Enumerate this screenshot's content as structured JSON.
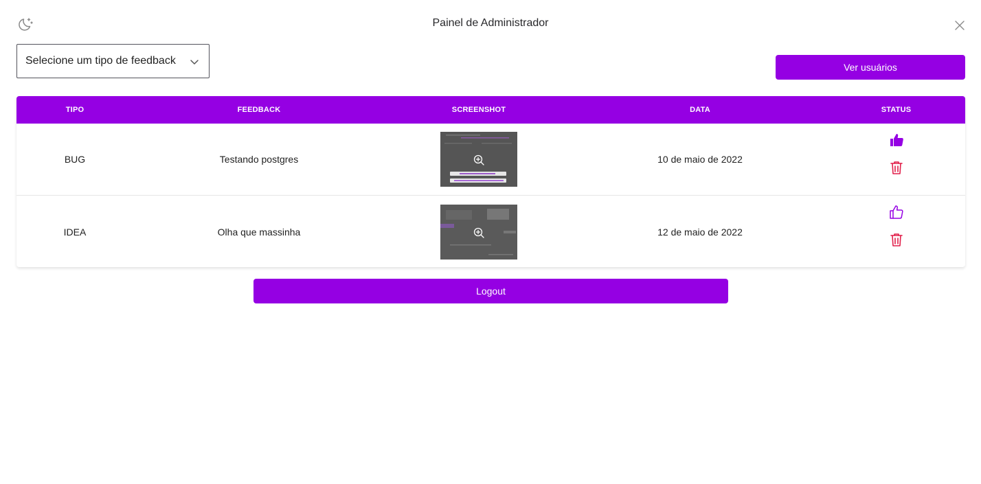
{
  "header": {
    "title": "Painel de Administrador"
  },
  "filter": {
    "selected": "Selecione um tipo de feedback"
  },
  "actions": {
    "users_label": "Ver usuários",
    "logout_label": "Logout"
  },
  "colors": {
    "accent": "#9500e3",
    "danger": "#e11d48"
  },
  "table": {
    "columns": [
      "TIPO",
      "FEEDBACK",
      "SCREENSHOT",
      "DATA",
      "STATUS"
    ],
    "rows": [
      {
        "tipo": "BUG",
        "feedback": "Testando postgres",
        "data": "10 de maio de 2022",
        "status_icon": "thumbs-up-filled-icon"
      },
      {
        "tipo": "IDEA",
        "feedback": "Olha que massinha",
        "data": "12 de maio de 2022",
        "status_icon": "thumbs-up-outline-icon"
      }
    ]
  }
}
